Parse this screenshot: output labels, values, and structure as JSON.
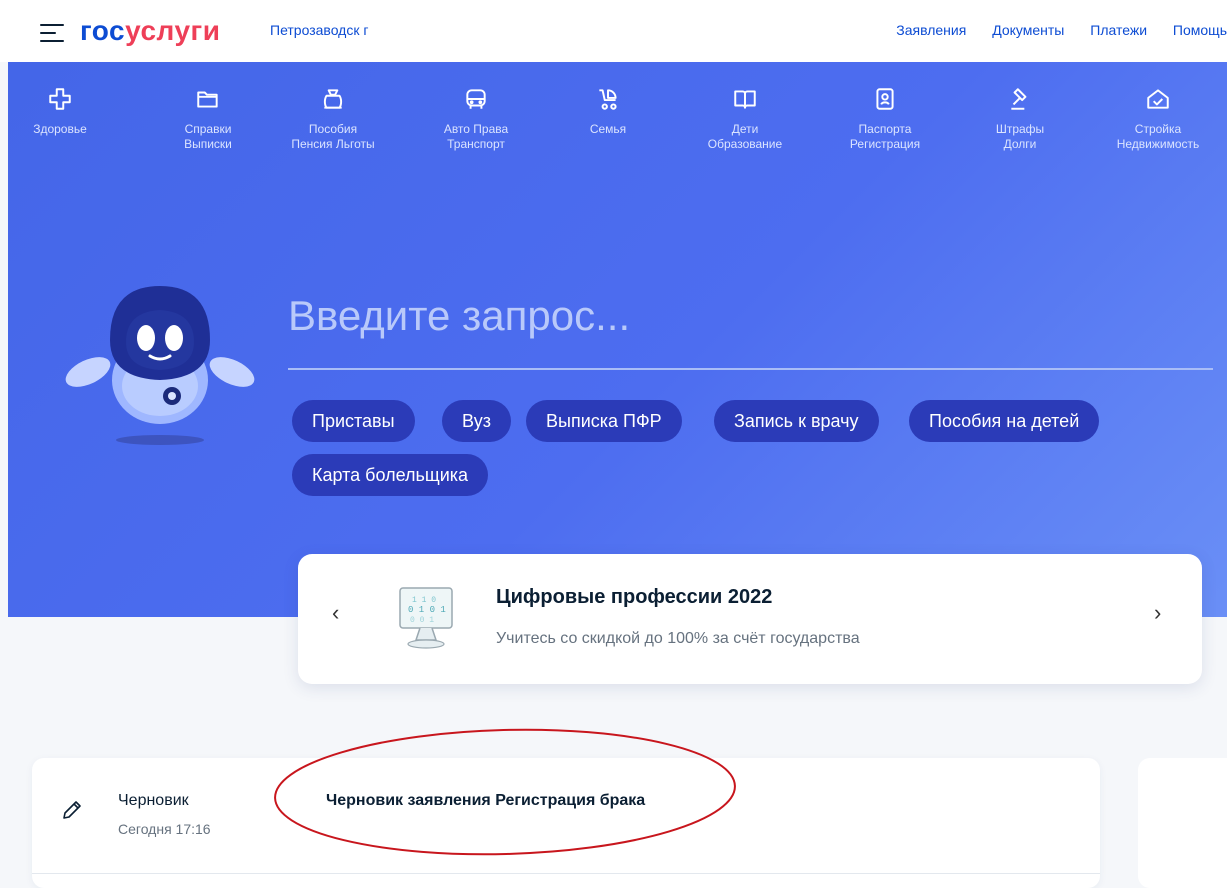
{
  "header": {
    "logo_part1": "гос",
    "logo_part2": "услуги",
    "city": "Петрозаводск г",
    "nav": [
      "Заявления",
      "Документы",
      "Платежи",
      "Помощь"
    ]
  },
  "categories": [
    {
      "line1": "Здоровье",
      "line2": "",
      "icon": "medical-cross-icon"
    },
    {
      "line1": "Справки",
      "line2": "Выписки",
      "icon": "folder-icon"
    },
    {
      "line1": "Пособия",
      "line2": "Пенсия Льготы",
      "icon": "wallet-icon"
    },
    {
      "line1": "Авто Права",
      "line2": "Транспорт",
      "icon": "car-icon"
    },
    {
      "line1": "Семья",
      "line2": "",
      "icon": "stroller-icon"
    },
    {
      "line1": "Дети",
      "line2": "Образование",
      "icon": "book-icon"
    },
    {
      "line1": "Паспорта",
      "line2": "Регистрация",
      "icon": "passport-icon"
    },
    {
      "line1": "Штрафы",
      "line2": "Долги",
      "icon": "gavel-icon"
    },
    {
      "line1": "Стройка",
      "line2": "Недвижимость",
      "icon": "house-icon"
    }
  ],
  "search": {
    "placeholder": "Введите запрос..."
  },
  "chips": [
    "Приставы",
    "Вуз",
    "Выписка ПФР",
    "Запись к врачу",
    "Пособия на детей",
    "Карта болельщика"
  ],
  "banner": {
    "title": "Цифровые профессии 2022",
    "subtitle": "Учитесь со скидкой до 100% за счёт государства",
    "prev": "‹",
    "next": "›"
  },
  "draft": {
    "label": "Черновик",
    "time": "Сегодня 17:16",
    "title": "Черновик заявления Регистрация брака"
  },
  "colors": {
    "brand_blue": "#0d4cd3",
    "brand_red": "#ee3f58",
    "hero": "#4d6df0",
    "chip": "#2b3bb8",
    "annotation": "#c8161d"
  }
}
